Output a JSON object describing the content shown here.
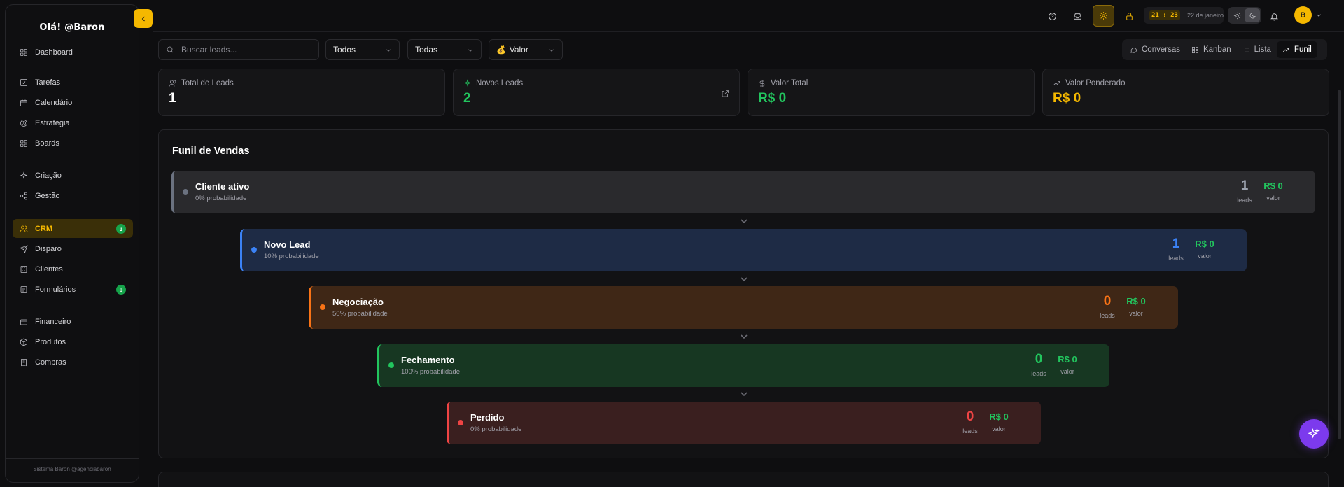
{
  "sidebar": {
    "greeting": "Olá! @Baron",
    "footer": "Sistema Baron @agenciabaron",
    "items": [
      {
        "label": "Dashboard",
        "icon": "grid-icon"
      },
      {
        "label": "Tarefas",
        "icon": "checkbox-icon"
      },
      {
        "label": "Calendário",
        "icon": "calendar-icon"
      },
      {
        "label": "Estratégia",
        "icon": "target-icon"
      },
      {
        "label": "Boards",
        "icon": "grid-icon"
      },
      {
        "label": "Criação",
        "icon": "sparkles-icon"
      },
      {
        "label": "Gestão",
        "icon": "share-icon"
      },
      {
        "label": "CRM",
        "icon": "users-icon",
        "badge": "3",
        "active": true
      },
      {
        "label": "Disparo",
        "icon": "send-icon"
      },
      {
        "label": "Clientes",
        "icon": "building-icon"
      },
      {
        "label": "Formulários",
        "icon": "form-icon",
        "badge": "1"
      },
      {
        "label": "Financeiro",
        "icon": "wallet-icon"
      },
      {
        "label": "Produtos",
        "icon": "box-icon"
      },
      {
        "label": "Compras",
        "icon": "receipt-icon"
      }
    ]
  },
  "topbar": {
    "time": "21 : 23",
    "date": "22 de janeiro",
    "avatar_initial": "B"
  },
  "filters": {
    "search_placeholder": "Buscar leads...",
    "status_value": "Todos",
    "category_value": "Todas",
    "sort_value": "Valor"
  },
  "views": [
    "Conversas",
    "Kanban",
    "Lista",
    "Funil"
  ],
  "active_view": "Funil",
  "stats": [
    {
      "label": "Total de Leads",
      "value": "1",
      "color": "#ffffff"
    },
    {
      "label": "Novos Leads",
      "value": "2",
      "color": "#22c55e"
    },
    {
      "label": "Valor Total",
      "value": "R$ 0",
      "color": "#22c55e"
    },
    {
      "label": "Valor Ponderado",
      "value": "R$ 0",
      "color": "#f5b800"
    }
  ],
  "funnel": {
    "title": "Funil de Vendas",
    "leads_label": "leads",
    "value_label": "valor",
    "stages": [
      {
        "name": "Cliente ativo",
        "probability": "0% probabilidade",
        "leads": "1",
        "value": "R$ 0",
        "color": "#6b7280",
        "bg": "#2a2a2d"
      },
      {
        "name": "Novo Lead",
        "probability": "10% probabilidade",
        "leads": "1",
        "value": "R$ 0",
        "color": "#3b82f6",
        "bg": "#1e2b45"
      },
      {
        "name": "Negociação",
        "probability": "50% probabilidade",
        "leads": "0",
        "value": "R$ 0",
        "color": "#f97316",
        "bg": "#3f2716"
      },
      {
        "name": "Fechamento",
        "probability": "100% probabilidade",
        "leads": "0",
        "value": "R$ 0",
        "color": "#22c55e",
        "bg": "#173722"
      },
      {
        "name": "Perdido",
        "probability": "0% probabilidade",
        "leads": "0",
        "value": "R$ 0",
        "color": "#ef4444",
        "bg": "#3a1f1f"
      }
    ]
  }
}
